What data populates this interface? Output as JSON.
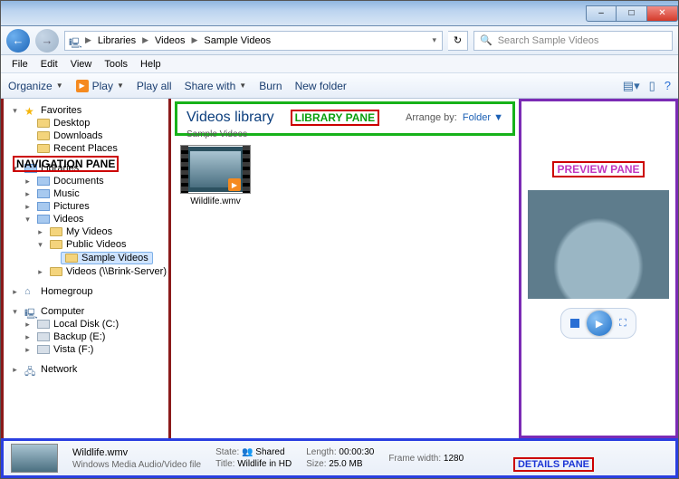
{
  "window": {
    "min": "–",
    "max": "□",
    "close": "✕"
  },
  "breadcrumb": {
    "seg1": "Libraries",
    "seg2": "Videos",
    "seg3": "Sample Videos",
    "dropdown_v": "▾",
    "refresh": "↻"
  },
  "search": {
    "placeholder": "Search Sample Videos"
  },
  "menu": {
    "file": "File",
    "edit": "Edit",
    "view": "View",
    "tools": "Tools",
    "help": "Help"
  },
  "toolbar": {
    "organize": "Organize",
    "play": "Play",
    "play_all": "Play all",
    "share": "Share with",
    "burn": "Burn",
    "new_folder": "New folder"
  },
  "nav_label": "NAVIGATION PANE",
  "tree": {
    "favorites": "Favorites",
    "desktop": "Desktop",
    "downloads": "Downloads",
    "recent": "Recent Places",
    "libraries": "Libraries",
    "documents": "Documents",
    "music": "Music",
    "pictures": "Pictures",
    "videos": "Videos",
    "my_videos": "My Videos",
    "public_videos": "Public Videos",
    "sample_videos": "Sample Videos",
    "videos_net": "Videos (\\\\Brink-Server)",
    "homegroup": "Homegroup",
    "computer": "Computer",
    "diskc": "Local Disk (C:)",
    "diske": "Backup (E:)",
    "diskf": "Vista (F:)",
    "network": "Network"
  },
  "lib": {
    "title": "Videos library",
    "sub": "Sample Videos",
    "label": "LIBRARY PANE",
    "arrange": "Arrange by:",
    "arrange_val": "Folder"
  },
  "item": {
    "name": "Wildlife.wmv"
  },
  "prev_label": "PREVIEW PANE",
  "details_label": "DETAILS PANE",
  "details": {
    "name": "Wildlife.wmv",
    "type": "Windows Media Audio/Video file",
    "state_l": "State:",
    "state_v": "Shared",
    "title_l": "Title:",
    "title_v": "Wildlife in HD",
    "len_l": "Length:",
    "len_v": "00:00:30",
    "size_l": "Size:",
    "size_v": "25.0 MB",
    "fw_l": "Frame width:",
    "fw_v": "1280"
  }
}
